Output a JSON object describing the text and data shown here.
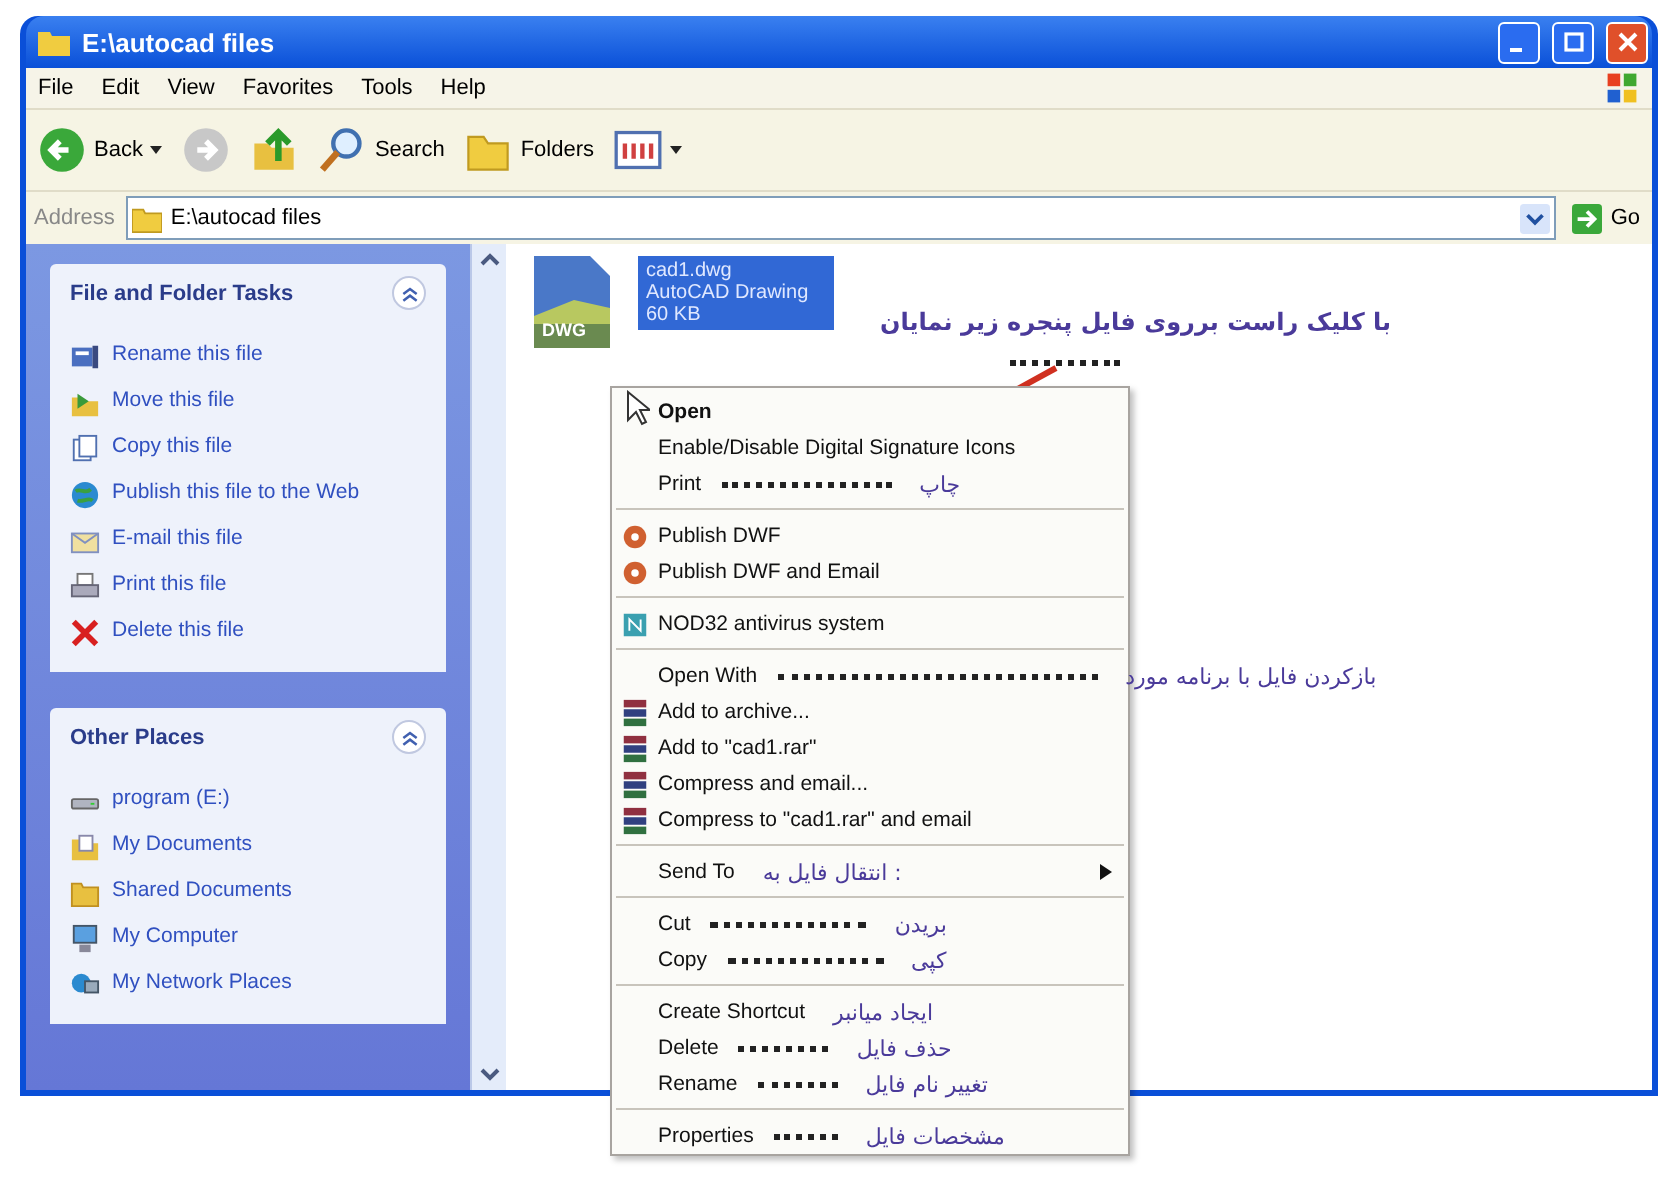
{
  "window": {
    "title": "E:\\autocad files"
  },
  "menu_bar": [
    "File",
    "Edit",
    "View",
    "Favorites",
    "Tools",
    "Help"
  ],
  "toolbar": [
    {
      "kind": "back",
      "label": "Back"
    },
    {
      "kind": "forward"
    },
    {
      "kind": "up"
    },
    {
      "kind": "search",
      "label": "Search"
    },
    {
      "kind": "folders",
      "label": "Folders"
    },
    {
      "kind": "views"
    }
  ],
  "address": {
    "label": "Address",
    "value": "E:\\autocad files",
    "go": "Go"
  },
  "task_panels": [
    {
      "title": "File and Folder Tasks",
      "items": [
        "Rename this file",
        "Move this file",
        "Copy this file",
        "Publish this file to the Web",
        "E-mail this file",
        "Print this file",
        "Delete this file"
      ]
    },
    {
      "title": "Other Places",
      "items": [
        "program (E:)",
        "My Documents",
        "Shared Documents",
        "My Computer",
        "My Network Places"
      ]
    }
  ],
  "file": {
    "badge": "DWG",
    "name": "cad1.dwg",
    "type": "AutoCAD Drawing",
    "size": "60 KB",
    "selected": true
  },
  "callout": {
    "text": "با کلیک راست برروی فایل پنجره زیر نمایان"
  },
  "context_menu": [
    [
      {
        "label": "Open",
        "bold": true,
        "submenu": false
      },
      {
        "label": "Enable/Disable Digital Signature Icons",
        "bold": false,
        "submenu": false
      },
      {
        "label": "Print",
        "bold": false,
        "submenu": false,
        "note": "چاپ"
      }
    ],
    [
      {
        "label": "Publish DWF",
        "bold": false,
        "submenu": false
      },
      {
        "label": "Publish DWF and Email",
        "bold": false,
        "submenu": false
      }
    ],
    [
      {
        "label": "NOD32 antivirus system",
        "bold": false,
        "submenu": false
      }
    ],
    [
      {
        "label": "Open With",
        "bold": false,
        "submenu": false,
        "note": "بازکردن فایل با برنامه مورد"
      },
      {
        "label": "Add to archive...",
        "bold": false,
        "submenu": false
      },
      {
        "label": "Add to \"cad1.rar\"",
        "bold": false,
        "submenu": false
      },
      {
        "label": "Compress and email...",
        "bold": false,
        "submenu": false
      },
      {
        "label": "Compress to \"cad1.rar\" and email",
        "bold": false,
        "submenu": false
      }
    ],
    [
      {
        "label": "Send To",
        "bold": false,
        "submenu": true,
        "note": ": انتقال فایل به"
      }
    ],
    [
      {
        "label": "Cut",
        "bold": false,
        "submenu": false,
        "note": "بریدن"
      },
      {
        "label": "Copy",
        "bold": false,
        "submenu": false,
        "note": "کپی"
      }
    ],
    [
      {
        "label": "Create Shortcut",
        "bold": false,
        "submenu": false,
        "note": "ایجاد میانبر"
      },
      {
        "label": "Delete",
        "bold": false,
        "submenu": false,
        "note": "حذف فایل"
      },
      {
        "label": "Rename",
        "bold": false,
        "submenu": false,
        "note": "تغییر نام فایل"
      }
    ],
    [
      {
        "label": "Properties",
        "bold": false,
        "submenu": false,
        "note": "مشخصات فایل"
      }
    ]
  ]
}
